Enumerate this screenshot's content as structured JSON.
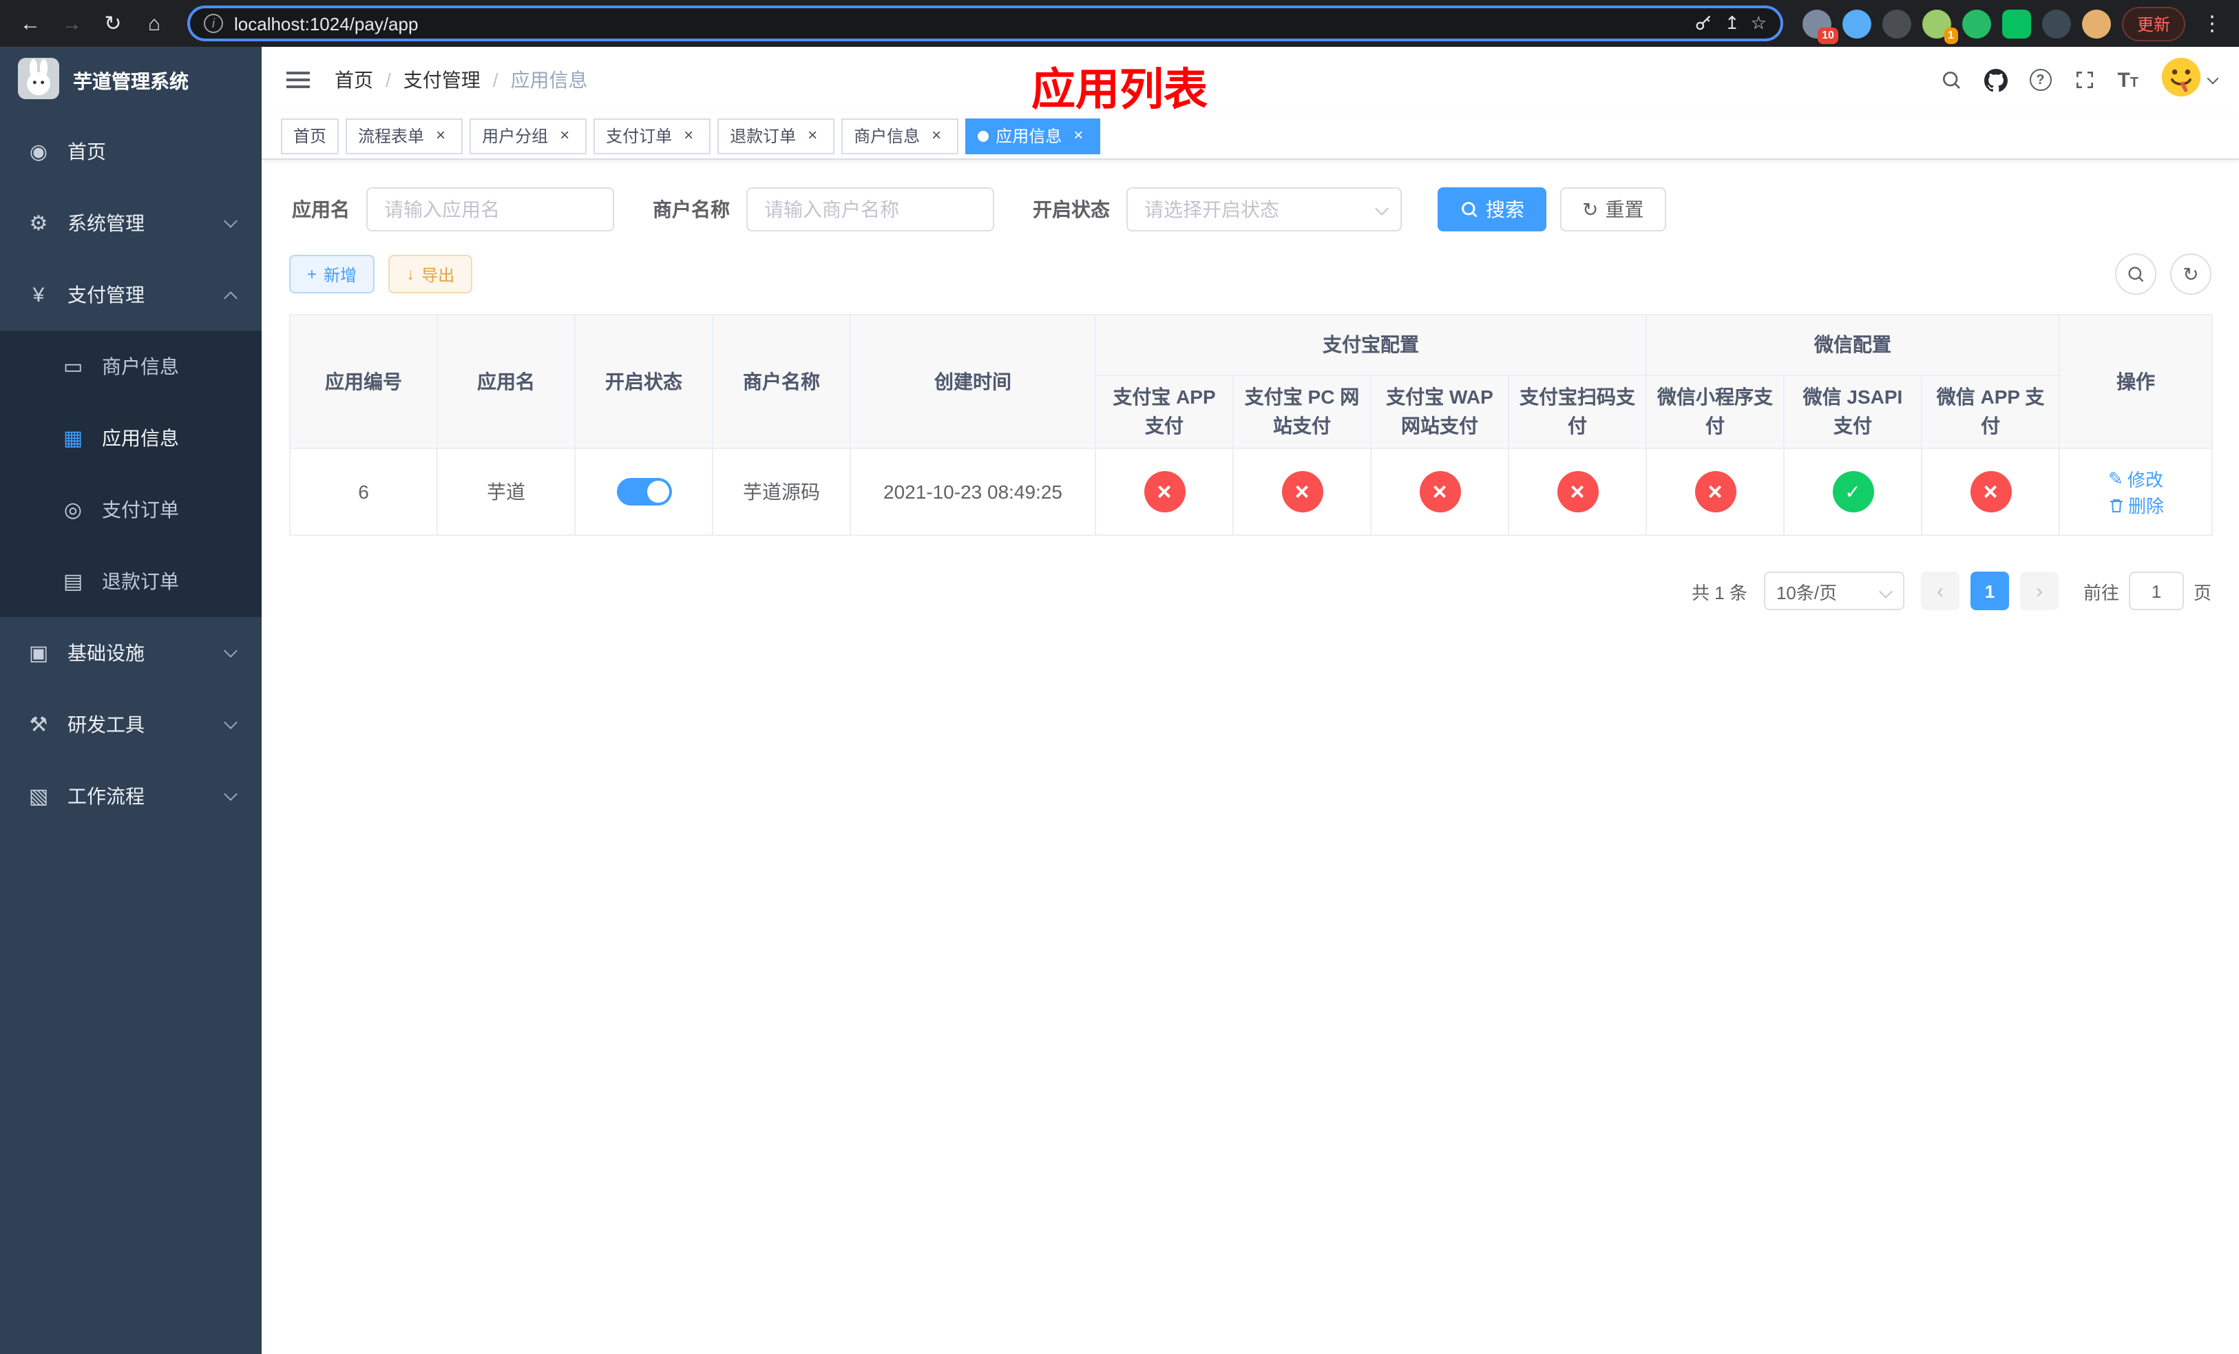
{
  "theme": {
    "accent": "#409eff",
    "success": "#13ce66",
    "danger": "#fa5050",
    "warning": "#e6a23c",
    "annotation_red": "#ff0000",
    "sidebar_bg": "#304156",
    "submenu_bg": "#1f2d3d"
  },
  "browser": {
    "url": "localhost:1024/pay/app",
    "update_button": "更新",
    "extension_badges": {
      "grid": "10",
      "avatar": "1"
    }
  },
  "icons": {
    "back": "←",
    "forward": "→",
    "reload": "↻",
    "home": "⌂",
    "info": "i",
    "share": "↥",
    "star": "☆",
    "menu_dots": "⋮",
    "help": "?",
    "close": "×",
    "plus": "+",
    "download": "↓",
    "refresh": "↻",
    "font_large": "T",
    "font_small": "T",
    "prev": "‹",
    "next": "›",
    "edit": "✎"
  },
  "sidebar": {
    "app_title": "芋道管理系统",
    "menu": [
      {
        "icon": "◉",
        "label": "首页"
      },
      {
        "icon": "⚙",
        "label": "系统管理"
      },
      {
        "icon": "¥",
        "label": "支付管理"
      },
      {
        "icon": "▣",
        "label": "基础设施"
      },
      {
        "icon": "⚒",
        "label": "研发工具"
      },
      {
        "icon": "▧",
        "label": "工作流程"
      }
    ],
    "submenu": [
      {
        "icon": "▭",
        "label": "商户信息"
      },
      {
        "icon": "▦",
        "label": "应用信息"
      },
      {
        "icon": "◎",
        "label": "支付订单"
      },
      {
        "icon": "▤",
        "label": "退款订单"
      }
    ]
  },
  "navbar": {
    "breadcrumb": [
      "首页",
      "支付管理",
      "应用信息"
    ],
    "separator": "/",
    "annotation": "应用列表"
  },
  "tabs": [
    {
      "label": "首页"
    },
    {
      "label": "流程表单"
    },
    {
      "label": "用户分组"
    },
    {
      "label": "支付订单"
    },
    {
      "label": "退款订单"
    },
    {
      "label": "商户信息"
    },
    {
      "label": "应用信息"
    }
  ],
  "filters": {
    "app_name_label": "应用名",
    "app_name_placeholder": "请输入应用名",
    "merchant_label": "商户名称",
    "merchant_placeholder": "请输入商户名称",
    "status_label": "开启状态",
    "status_placeholder": "请选择开启状态",
    "search_button": "搜索",
    "reset_button": "重置"
  },
  "toolbar": {
    "add_button": "新增",
    "export_button": "导出"
  },
  "table": {
    "group_headers": {
      "alipay": "支付宝配置",
      "wechat": "微信配置"
    },
    "main_headers": [
      "应用编号",
      "应用名",
      "开启状态",
      "商户名称",
      "创建时间",
      "操作"
    ],
    "sub_headers": [
      "支付宝 APP 支付",
      "支付宝 PC 网站支付",
      "支付宝 WAP 网站支付",
      "支付宝扫码支付",
      "微信小程序支付",
      "微信 JSAPI 支付",
      "微信 APP 支付"
    ],
    "rows": [
      {
        "id": "6",
        "name": "芋道",
        "switch": "on",
        "merchant": "芋道源码",
        "created_at": "2021-10-23 08:49:25",
        "pay_states": [
          "fail",
          "fail",
          "fail",
          "fail",
          "fail",
          "success",
          "fail"
        ],
        "edit_label": "修改",
        "delete_label": "删除"
      }
    ]
  },
  "pagination": {
    "total": "共 1 条",
    "page_size": "10条/页",
    "current_page": "1",
    "goto_prefix": "前往",
    "goto_value": "1",
    "goto_suffix": "页"
  }
}
